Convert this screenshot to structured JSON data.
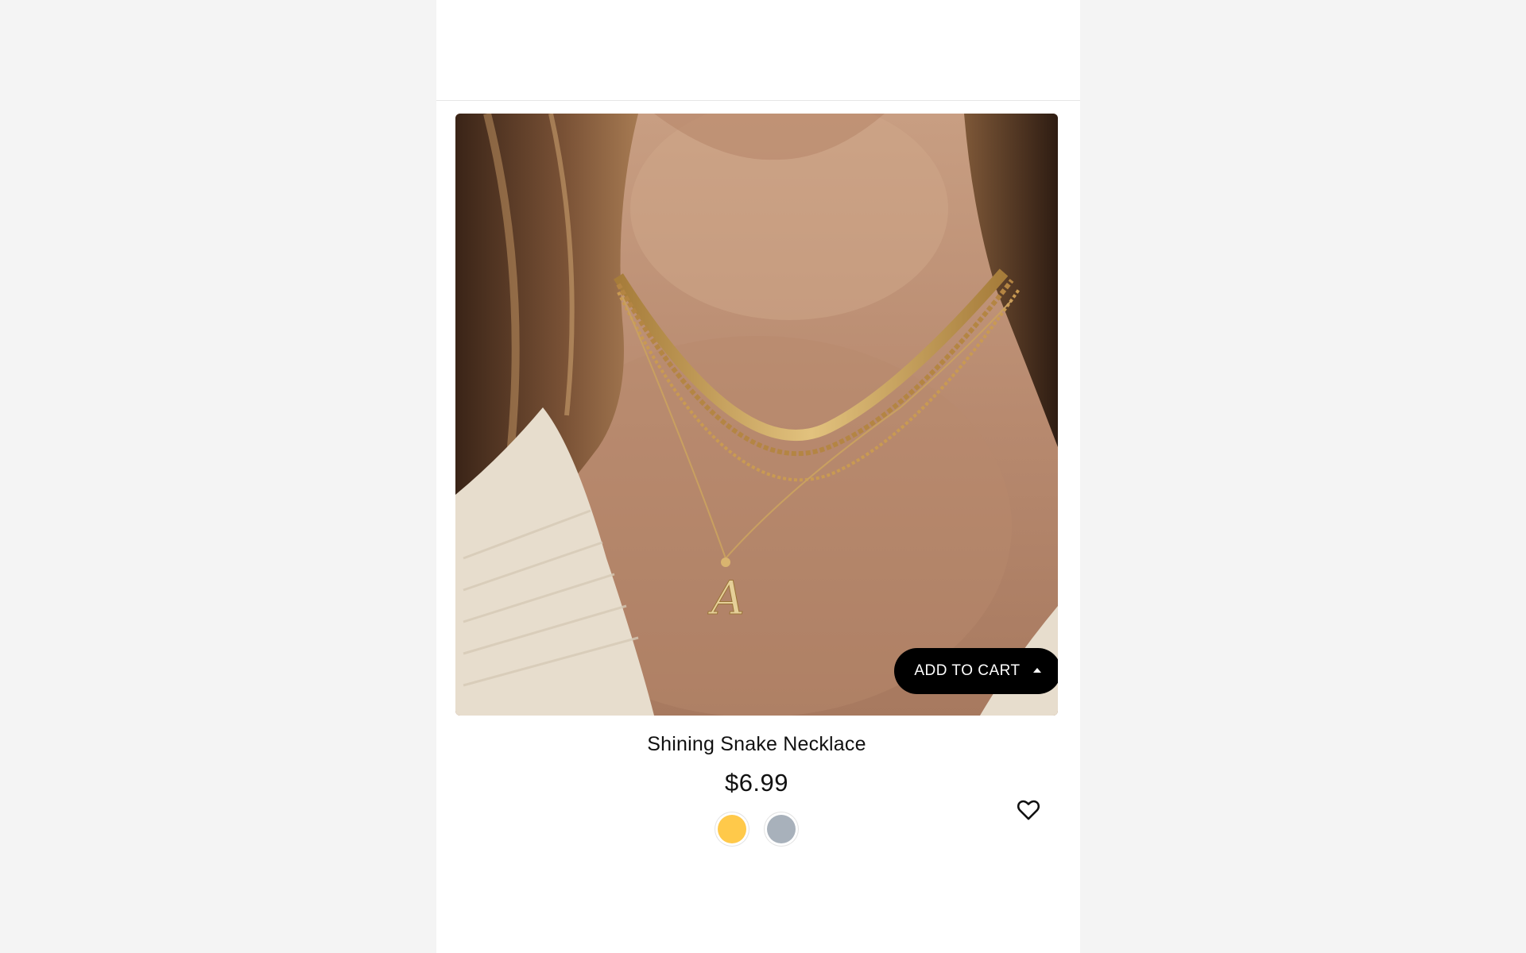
{
  "product": {
    "name": "Shining Snake Necklace",
    "price": "$6.99",
    "image_alt": "Woman wearing layered gold necklaces with letter A pendant",
    "add_to_cart_label": "ADD TO CART"
  },
  "swatches": [
    {
      "name": "gold",
      "color": "#ffc94a"
    },
    {
      "name": "silver",
      "color": "#a8b1bb"
    }
  ],
  "icons": {
    "wishlist": "heart-icon",
    "cart_caret": "caret-up-icon"
  }
}
